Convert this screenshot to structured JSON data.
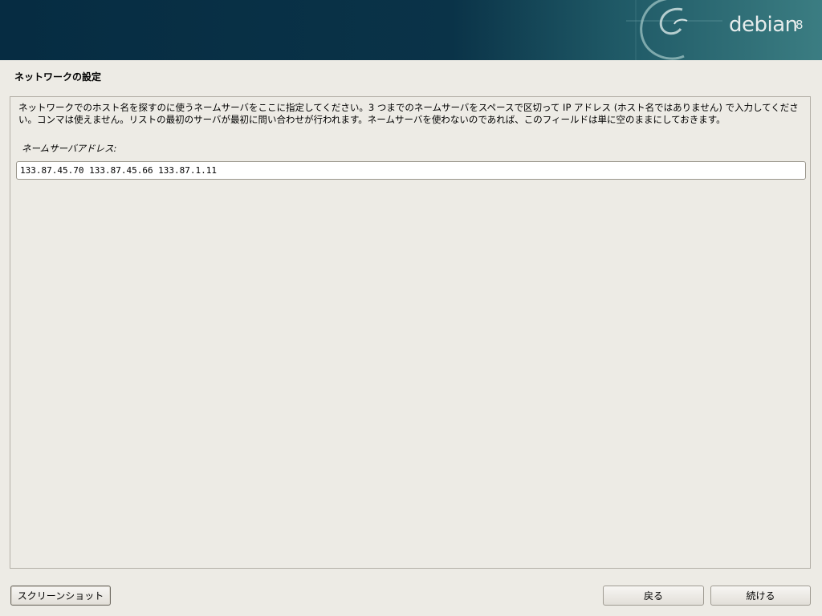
{
  "banner": {
    "logo_text": "debian",
    "logo_version": "8"
  },
  "page": {
    "title": "ネットワークの設定"
  },
  "panel": {
    "description": "ネットワークでのホスト名を探すのに使うネームサーバをここに指定してください。3 つまでのネームサーバをスペースで区切って IP アドレス (ホスト名ではありません) で入力してください。コンマは使えません。リストの最初のサーバが最初に問い合わせが行われます。ネームサーバを使わないのであれば、このフィールドは単に空のままにしておきます。",
    "field_label": "ネームサーバアドレス:",
    "field_value": "133.87.45.70 133.87.45.66 133.87.1.11"
  },
  "buttons": {
    "screenshot": "スクリーンショット",
    "back": "戻る",
    "continue": "続ける"
  }
}
